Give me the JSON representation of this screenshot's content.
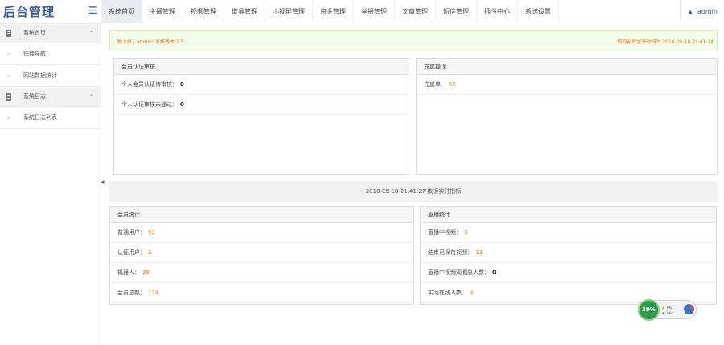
{
  "app": {
    "title": "后台管理",
    "user": "admin"
  },
  "nav": {
    "items": [
      "系统首页",
      "主播管理",
      "视频管理",
      "道具管理",
      "小视屏管理",
      "资金管理",
      "举报管理",
      "文章管理",
      "短信管理",
      "插件中心",
      "系统设置"
    ],
    "active": 0
  },
  "sidebar": {
    "groups": [
      {
        "label": "系统首页",
        "items": [
          "快捷导航",
          "网站数据统计"
        ]
      },
      {
        "label": "系统日志",
        "items": [
          "系统日志列表"
        ]
      }
    ]
  },
  "welcome": {
    "left": "晚上好，admin! 系统版本:2.5",
    "right": "你的最后登录时间为 2018-05-18 21:41:24"
  },
  "member_audit": {
    "title": "会员认证审核",
    "rows": [
      {
        "label": "个人会员认证待审核：",
        "value": "0"
      },
      {
        "label": "个人认证审核未通过：",
        "value": "0"
      }
    ]
  },
  "recharge": {
    "title": "充值提现",
    "rows": [
      {
        "label": "充值单：",
        "value": "69"
      }
    ]
  },
  "realtime": {
    "text": "2018-05-18 21:41:27 数据实时指标"
  },
  "member_stats": {
    "title": "会员统计",
    "rows": [
      {
        "label": "普通用户：",
        "value": "93"
      },
      {
        "label": "认证用户：",
        "value": "3"
      },
      {
        "label": "机器人：",
        "value": "28"
      },
      {
        "label": "会员总数：",
        "value": "124"
      }
    ]
  },
  "live_stats": {
    "title": "直播统计",
    "rows": [
      {
        "label": "直播中视频：",
        "value": "3"
      },
      {
        "label": "结束已保存视频：",
        "value": "13"
      },
      {
        "label": "直播中视频观看总人数：",
        "value": "0"
      },
      {
        "label": "实际在线人数：",
        "value": "4"
      }
    ]
  },
  "speed_widget": {
    "percent": "39%",
    "up": "0K/s",
    "down": "0K/s"
  },
  "colors": {
    "accent": "#3a5a8c",
    "orange": "#e07a1c",
    "green": "#2e9a4a"
  }
}
